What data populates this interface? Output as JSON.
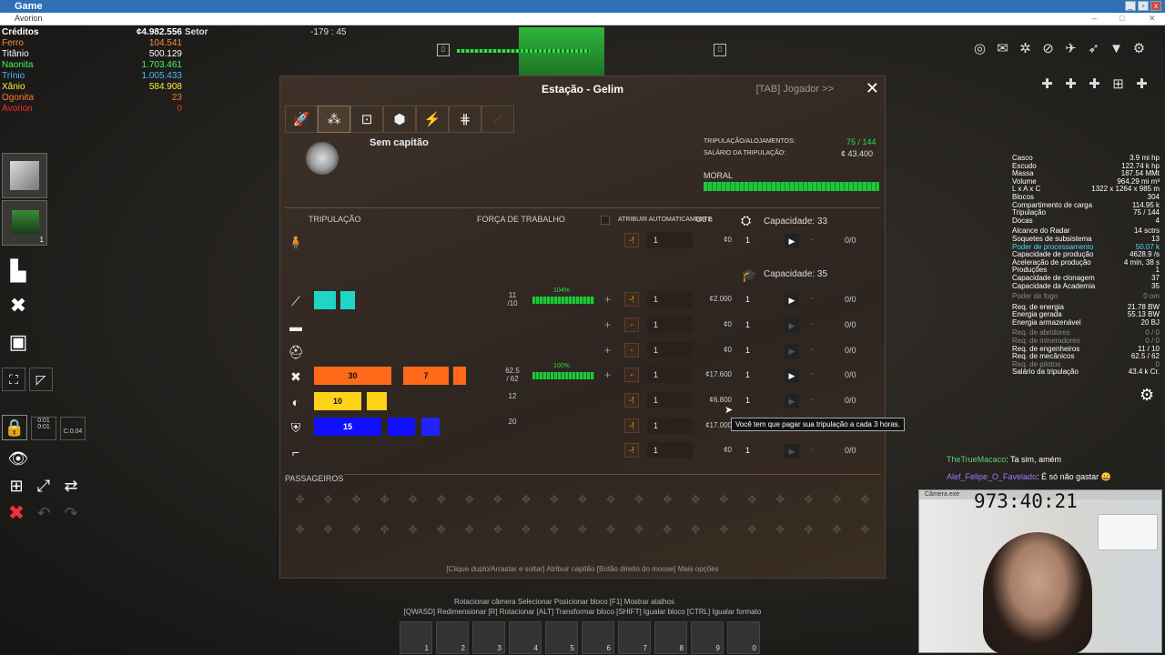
{
  "window": {
    "title": "Game",
    "app": "Avorion"
  },
  "resources": {
    "credits_label": "Créditos",
    "credits_value": "¢4.982.556",
    "sector_label": "Setor",
    "coords": "-179 : 45",
    "items": [
      {
        "name": "Ferro",
        "value": "104.541",
        "color": "#ff8c3a"
      },
      {
        "name": "Titânio",
        "value": "500.129",
        "color": "#ffffff"
      },
      {
        "name": "Naonita",
        "value": "1.703.461",
        "color": "#3cff52"
      },
      {
        "name": "Trínio",
        "value": "1.005.433",
        "color": "#4ab8ff"
      },
      {
        "name": "Xânio",
        "value": "584.908",
        "color": "#ffe94a"
      },
      {
        "name": "Ogonita",
        "value": "23",
        "color": "#ff7a20"
      },
      {
        "name": "Avorion",
        "value": "0",
        "color": "#ff2a2a"
      }
    ]
  },
  "left_toolbar": {
    "build_count": "1",
    "stat1": "0:01",
    "stat2": "0:01",
    "stat3": "C:0.04"
  },
  "panel": {
    "title": "Estação - Gelim",
    "tab_player": "[TAB] Jogador   >>",
    "close": "✕",
    "captain_label": "Sem capitão",
    "crew_quarters_label": "TRIPULAÇÃO/ALOJAMENTOS:",
    "crew_quarters_value": "75 / 144",
    "crew_salary_label": "SALÁRIO DA TRIPULAÇÃO:",
    "crew_salary_value": "¢ 43.400",
    "morale_label": "MORAL",
    "crew_header": "TRIPULAÇÃO",
    "workforce_header": "FORÇA DE TRABALHO",
    "auto_assign_label": "ATRIBUIR AUTOMATICAMENTE",
    "auto_assign_extra": "0/3 h",
    "capacity1": "Capacidade: 33",
    "capacity2": "Capacidade: 35",
    "passengers_label": "PASSAGEIROS",
    "hint": "[Clique duplo/Arrastar e soltar] Atribuir capitão     [Botão direito do mouse] Mais opções",
    "tooltip": "Você tem que pagar sua tripulação a cada 3 horas.",
    "rows": [
      {
        "icon": "person",
        "count": "",
        "pct": "",
        "input": "1",
        "price": "¢0",
        "num2": "1",
        "frac": "0/0",
        "minus": "-!"
      },
      {
        "icon": "wrench",
        "count": "11\n/10",
        "pct": "104%",
        "input": "1",
        "price": "¢2.000",
        "num2": "1",
        "frac": "0/0",
        "minus": "-!",
        "fig_a": "",
        "fig_b": ""
      },
      {
        "icon": "gun",
        "count": "",
        "pct": "",
        "input": "1",
        "price": "¢0",
        "num2": "1",
        "frac": "0/0",
        "minus": "-"
      },
      {
        "icon": "helmet",
        "count": "",
        "pct": "",
        "input": "1",
        "price": "¢0",
        "num2": "1",
        "frac": "0/0",
        "minus": "-"
      },
      {
        "icon": "tools",
        "count": "62.5\n/ 62",
        "pct": "100%",
        "input": "1",
        "price": "¢17.600",
        "num2": "1",
        "frac": "0/0",
        "minus": "-",
        "fig_a": "30",
        "fig_b": "7"
      },
      {
        "icon": "pilot",
        "count": "12",
        "pct": "",
        "input": "1",
        "price": "¢6.800",
        "num2": "1",
        "frac": "0/0",
        "minus": "-!",
        "fig_a": "10",
        "fig_b": ""
      },
      {
        "icon": "security",
        "count": "20",
        "pct": "",
        "input": "1",
        "price": "¢17.000",
        "num2": "",
        "frac": "",
        "minus": "-!",
        "fig_a": "15",
        "fig_b": ""
      },
      {
        "icon": "boarder",
        "count": "",
        "pct": "",
        "input": "1",
        "price": "¢0",
        "num2": "1",
        "frac": "0/0",
        "minus": "-!"
      }
    ]
  },
  "stats": [
    {
      "k": "Casco",
      "v": "3.9 mi hp",
      "s": ""
    },
    {
      "k": "Escudo",
      "v": "122.74 k hp",
      "s": ""
    },
    {
      "k": "Massa",
      "v": "187.54 MMt",
      "s": ""
    },
    {
      "k": "Volume",
      "v": "964.29 mi m³",
      "s": ""
    },
    {
      "k": "L x A x C",
      "v": "1322 x 1264 x 985 m",
      "s": ""
    },
    {
      "k": "Blocos",
      "v": "304",
      "s": ""
    },
    {
      "k": "Compartimento de carga",
      "v": "114.95 k",
      "s": ""
    },
    {
      "k": "Tripulação",
      "v": "75 / 144",
      "s": ""
    },
    {
      "k": "Docas",
      "v": "4",
      "s": ""
    },
    {
      "k": "",
      "v": "",
      "s": "gap"
    },
    {
      "k": "Alcance do Radar",
      "v": "14 sctrs",
      "s": ""
    },
    {
      "k": "Soquetes de subsistema",
      "v": "13",
      "s": ""
    },
    {
      "k": "Poder de processamento",
      "v": "50.07 k",
      "s": "hl"
    },
    {
      "k": "Capacidade de produção",
      "v": "4628.9 /s",
      "s": ""
    },
    {
      "k": "Aceleração de produção",
      "v": "4 min, 38 s",
      "s": ""
    },
    {
      "k": "Produções",
      "v": "1",
      "s": ""
    },
    {
      "k": "Capacidade de clonagem",
      "v": "37",
      "s": ""
    },
    {
      "k": "Capacidade da Academia",
      "v": "35",
      "s": ""
    },
    {
      "k": "",
      "v": "",
      "s": "gap"
    },
    {
      "k": "Poder de fogo",
      "v": "0 om",
      "s": "dim"
    },
    {
      "k": "",
      "v": "",
      "s": "gap"
    },
    {
      "k": "Req. de energia",
      "v": "21.78 BW",
      "s": ""
    },
    {
      "k": "Energia gerada",
      "v": "55.13 BW",
      "s": ""
    },
    {
      "k": "Energia armazenável",
      "v": "20 BJ",
      "s": ""
    },
    {
      "k": "",
      "v": "",
      "s": "gap"
    },
    {
      "k": "Req. de abridores",
      "v": "0 / 0",
      "s": "dim"
    },
    {
      "k": "Req. de mineradores",
      "v": "0 / 0",
      "s": "dim"
    },
    {
      "k": "Req. de engenheiros",
      "v": "11 / 10",
      "s": ""
    },
    {
      "k": "Req. de mecânicos",
      "v": "62.5 / 62",
      "s": ""
    },
    {
      "k": "Req. de pilotos",
      "v": "0",
      "s": "dim"
    },
    {
      "k": "Salário da tripulação",
      "v": "43.4 k Cr.",
      "s": ""
    }
  ],
  "chat": [
    {
      "user": "TheTrueMacaco",
      "msg": ": Ta sim, amém",
      "color": "#5fd07a"
    },
    {
      "user": "Alef_Felipe_O_Favelado",
      "msg": ": É só não gastar 😀",
      "color": "#9b7bff"
    }
  ],
  "camera": {
    "title": "Câmera.exe",
    "timer": "973:40:21"
  },
  "bottom": {
    "line1": "Rotacionar câmera       Selecionar              Posicionar bloco        [F1] Mostrar atalhos",
    "line2": "[QWASD] Redimensionar  [R] Rotacionar  [ALT] Transformar bloco  [SHIFT] Igualar bloco  [CTRL] Igualar formato",
    "slots": [
      "1",
      "2",
      "3",
      "4",
      "5",
      "6",
      "7",
      "8",
      "9",
      "0"
    ]
  }
}
